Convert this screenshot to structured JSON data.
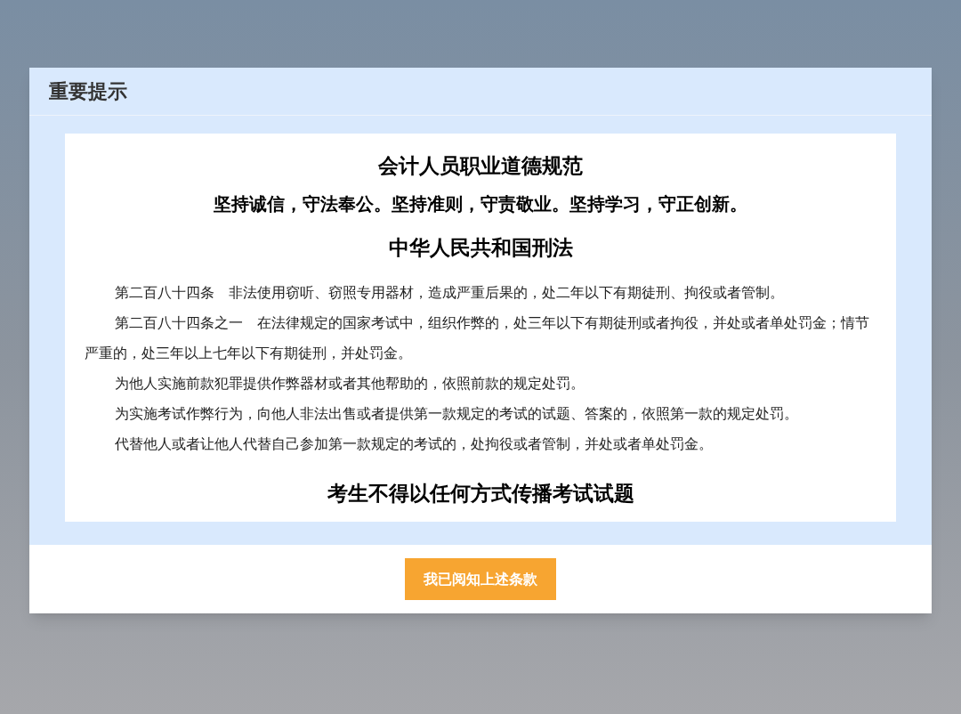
{
  "dialog": {
    "title": "重要提示",
    "sections": [
      {
        "kind": "heading",
        "text": "会计人员职业道德规范"
      },
      {
        "kind": "motto",
        "text": "坚持诚信，守法奉公。坚持准则，守责敬业。坚持学习，守正创新。"
      },
      {
        "kind": "heading",
        "text": "中华人民共和国刑法"
      },
      {
        "kind": "paragraph",
        "text": "第二百八十四条　非法使用窃听、窃照专用器材，造成严重后果的，处二年以下有期徒刑、拘役或者管制。"
      },
      {
        "kind": "paragraph",
        "text": "第二百八十四条之一　在法律规定的国家考试中，组织作弊的，处三年以下有期徒刑或者拘役，并处或者单处罚金；情节严重的，处三年以上七年以下有期徒刑，并处罚金。"
      },
      {
        "kind": "paragraph",
        "text": "为他人实施前款犯罪提供作弊器材或者其他帮助的，依照前款的规定处罚。"
      },
      {
        "kind": "paragraph",
        "text": "为实施考试作弊行为，向他人非法出售或者提供第一款规定的考试的试题、答案的，依照第一款的规定处罚。"
      },
      {
        "kind": "paragraph",
        "text": "代替他人或者让他人代替自己参加第一款规定的考试的，处拘役或者管制，并处或者单处罚金。"
      },
      {
        "kind": "heading",
        "text": "考生不得以任何方式传播考试试题"
      }
    ],
    "button": "我已阅知上述条款"
  }
}
